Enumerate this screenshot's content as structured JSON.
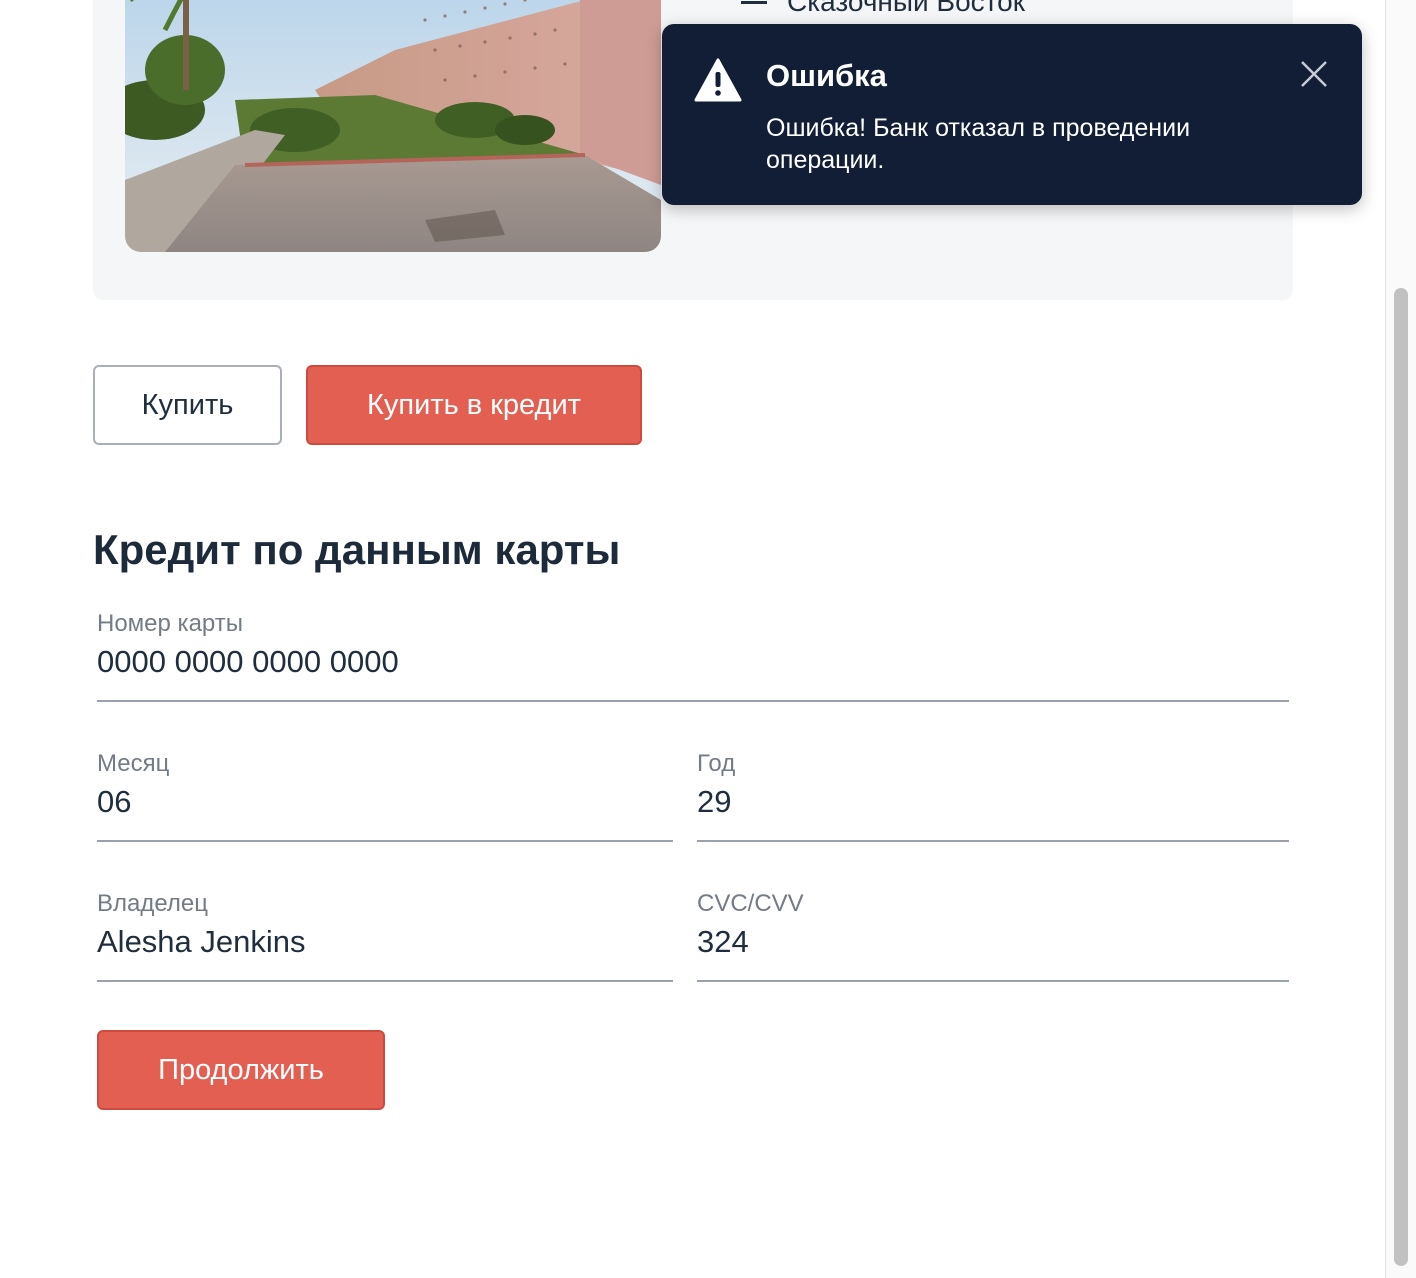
{
  "tour": {
    "feature_text": "Сказочный Восток"
  },
  "actions": {
    "buy_label": "Купить",
    "buy_credit_label": "Купить в кредит"
  },
  "form": {
    "title": "Кредит по данным карты",
    "card_number": {
      "label": "Номер карты",
      "value": "0000 0000 0000 0000"
    },
    "month": {
      "label": "Месяц",
      "value": "06"
    },
    "year": {
      "label": "Год",
      "value": "29"
    },
    "owner": {
      "label": "Владелец",
      "value": "Alesha Jenkins"
    },
    "cvc": {
      "label": "CVC/CVV",
      "value": "324"
    },
    "continue_label": "Продолжить"
  },
  "notification": {
    "title": "Ошибка",
    "message": "Ошибка! Банк отказал в проведении операции.",
    "icon": "warning-icon",
    "close_icon": "close-icon"
  },
  "colors": {
    "accent": "#e35f52",
    "toast_bg": "#111e36",
    "text": "#1f2d3d"
  }
}
